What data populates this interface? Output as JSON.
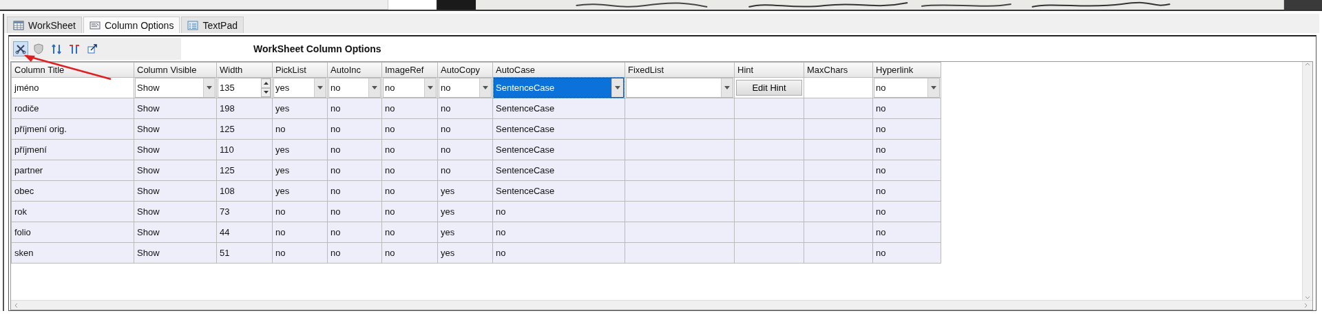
{
  "tabs": [
    {
      "label": "WorkSheet",
      "selected": false
    },
    {
      "label": "Column Options",
      "selected": true
    },
    {
      "label": "TextPad",
      "selected": false
    }
  ],
  "toolbar": {
    "title": "WorkSheet Column Options"
  },
  "table": {
    "columns": [
      {
        "title": "Column Title",
        "kind": "text"
      },
      {
        "title": "Column Visible",
        "kind": "combo"
      },
      {
        "title": "Width",
        "kind": "spinner"
      },
      {
        "title": "PickList",
        "kind": "combo"
      },
      {
        "title": "AutoInc",
        "kind": "combo"
      },
      {
        "title": "ImageRef",
        "kind": "combo"
      },
      {
        "title": "AutoCopy",
        "kind": "combo"
      },
      {
        "title": "AutoCase",
        "kind": "combo"
      },
      {
        "title": "FixedList",
        "kind": "combo"
      },
      {
        "title": "Hint",
        "kind": "button"
      },
      {
        "title": "MaxChars"
      },
      {
        "title": "Hyperlink",
        "kind": "combo"
      }
    ],
    "rows": [
      {
        "kind": "editor",
        "cells": [
          {
            "value": "jméno"
          },
          {
            "value": "Show",
            "selected": false
          },
          {
            "value": "135"
          },
          {
            "value": "yes",
            "selected": false
          },
          {
            "value": "no",
            "selected": false
          },
          {
            "value": "no",
            "selected": false
          },
          {
            "value": "no",
            "selected": false
          },
          {
            "value": "SentenceCase",
            "selected": true
          },
          {
            "selected": false
          },
          {
            "value": "Edit Hint"
          },
          null,
          {
            "value": "no",
            "selected": false
          }
        ]
      },
      {
        "kind": "plain",
        "cells": [
          "rodiče",
          "Show",
          "198",
          "yes",
          "no",
          "no",
          "no",
          "SentenceCase",
          null,
          null,
          null,
          "no"
        ]
      },
      {
        "kind": "plain",
        "cells": [
          "příjmení orig.",
          "Show",
          "125",
          "no",
          "no",
          "no",
          "no",
          "SentenceCase",
          null,
          null,
          null,
          "no"
        ]
      },
      {
        "kind": "plain",
        "cells": [
          "příjmení",
          "Show",
          "110",
          "yes",
          "no",
          "no",
          "no",
          "SentenceCase",
          null,
          null,
          null,
          "no"
        ]
      },
      {
        "kind": "plain",
        "cells": [
          "partner",
          "Show",
          "125",
          "yes",
          "no",
          "no",
          "no",
          "SentenceCase",
          null,
          null,
          null,
          "no"
        ]
      },
      {
        "kind": "plain",
        "cells": [
          "obec",
          "Show",
          "108",
          "yes",
          "no",
          "no",
          "yes",
          "SentenceCase",
          null,
          null,
          null,
          "no"
        ]
      },
      {
        "kind": "plain",
        "cells": [
          "rok",
          "Show",
          "73",
          "no",
          "no",
          "no",
          "yes",
          "no",
          null,
          null,
          null,
          "no"
        ]
      },
      {
        "kind": "plain",
        "cells": [
          "folio",
          "Show",
          "44",
          "no",
          "no",
          "no",
          "yes",
          "no",
          null,
          null,
          null,
          "no"
        ]
      },
      {
        "kind": "plain",
        "cells": [
          "sken",
          "Show",
          "51",
          "no",
          "no",
          "no",
          "yes",
          "no",
          null,
          null,
          null,
          "no"
        ]
      }
    ]
  }
}
